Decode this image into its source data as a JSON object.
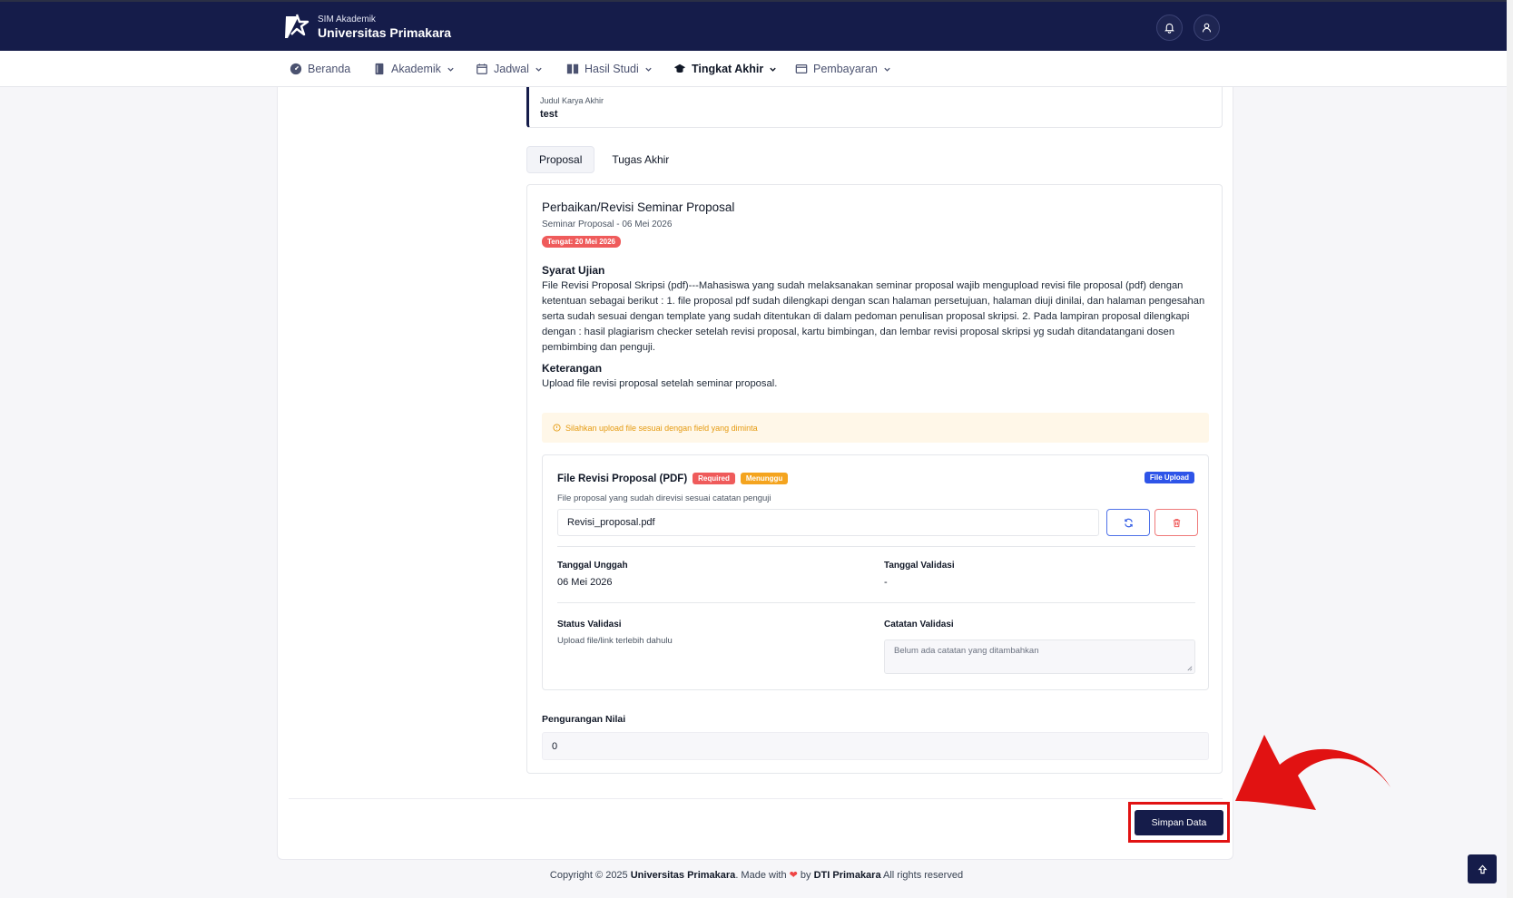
{
  "header": {
    "brand_sub": "SIM Akademik",
    "brand_main": "Universitas Primakara",
    "notif_icon": "bell-icon",
    "profile_icon": "user-icon"
  },
  "nav": {
    "items": [
      {
        "label": "Beranda",
        "icon": "dashboard-icon"
      },
      {
        "label": "Akademik",
        "icon": "book-icon"
      },
      {
        "label": "Jadwal",
        "icon": "calendar-icon"
      },
      {
        "label": "Hasil Studi",
        "icon": "columns-icon"
      },
      {
        "label": "Tingkat Akhir",
        "icon": "graduation-cap-icon",
        "active": true
      },
      {
        "label": "Pembayaran",
        "icon": "wallet-icon"
      }
    ]
  },
  "judul": {
    "label": "Judul Karya Akhir",
    "value": "test"
  },
  "tabs": [
    {
      "label": "Proposal",
      "active": true
    },
    {
      "label": "Tugas Akhir",
      "active": false
    }
  ],
  "panel": {
    "title": "Perbaikan/Revisi Seminar Proposal",
    "subtitle": "Seminar Proposal - 06 Mei 2026",
    "deadline": "Tengat: 20 Mei 2026",
    "syarat_heading": "Syarat Ujian",
    "syarat_text": "File Revisi Proposal Skripsi (pdf)---Mahasiswa yang sudah melaksanakan seminar proposal wajib mengupload revisi file proposal (pdf) dengan ketentuan sebagai berikut : 1. file proposal pdf sudah dilengkapi dengan scan halaman persetujuan, halaman diuji dinilai, dan halaman pengesahan serta sudah sesuai dengan template yang sudah ditentukan di dalam pedoman penulisan proposal skripsi. 2. Pada lampiran proposal dilengkapi dengan : hasil plagiarism checker setelah revisi proposal, kartu bimbingan, dan lembar revisi proposal skripsi yg sudah ditandatangani dosen pembimbing dan penguji.",
    "keterangan_heading": "Keterangan",
    "keterangan_text": "Upload file revisi proposal setelah seminar proposal.",
    "warning": "Silahkan upload file sesuai dengan field yang diminta"
  },
  "field": {
    "title": "File Revisi Proposal (PDF)",
    "required_badge": "Required",
    "status_badge": "Menunggu",
    "type_badge": "File Upload",
    "description": "File proposal yang sudah direvisi sesuai catatan penguji",
    "file_name": "Revisi_proposal.pdf",
    "tanggal_unggah_label": "Tanggal Unggah",
    "tanggal_unggah_value": "06 Mei 2026",
    "tanggal_validasi_label": "Tanggal Validasi",
    "tanggal_validasi_value": "-",
    "status_validasi_label": "Status Validasi",
    "status_validasi_value": "Upload file/link terlebih dahulu",
    "catatan_validasi_label": "Catatan Validasi",
    "catatan_validasi_placeholder": "Belum ada catatan yang ditambahkan"
  },
  "pengurangan": {
    "label": "Pengurangan Nilai",
    "value": "0"
  },
  "save_label": "Simpan Data",
  "footer": {
    "prefix": "Copyright © 2025",
    "university": "Universitas Primakara",
    "made_with": ". Made with",
    "by": "by",
    "org": "DTI Primakara",
    "suffix": "All rights reserved"
  },
  "colors": {
    "primary": "#151c4a",
    "danger": "#ef5b5b",
    "warning": "#f4a41f",
    "info": "#2e54e8",
    "annotation": "#e11212"
  }
}
